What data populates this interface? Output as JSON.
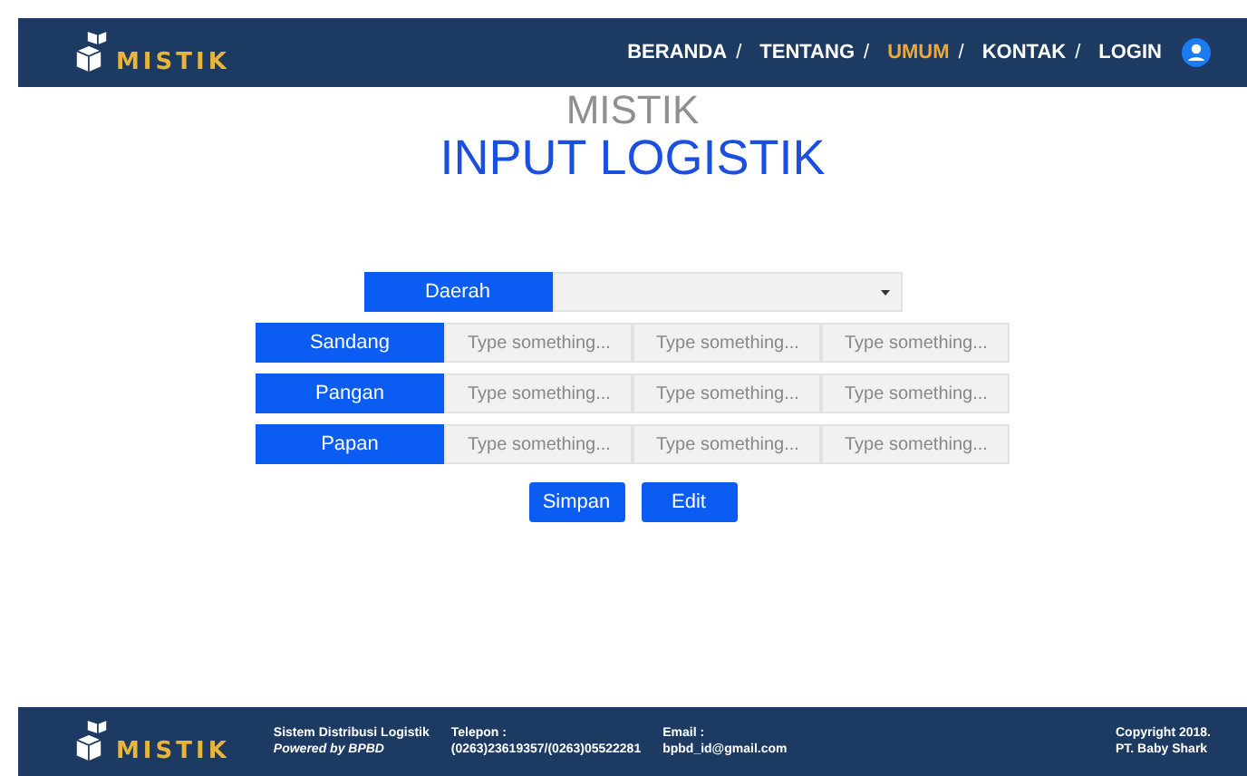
{
  "header": {
    "logo_text": "MISTIK",
    "nav": [
      {
        "label": "BERANDA",
        "selected": false
      },
      {
        "label": "TENTANG",
        "selected": false
      },
      {
        "label": "UMUM",
        "selected": true
      },
      {
        "label": "KONTAK",
        "selected": false
      },
      {
        "label": "LOGIN",
        "selected": false
      }
    ],
    "separator": "/"
  },
  "page": {
    "backdrop_text": "MISTIK",
    "title": "INPUT LOGISTIK"
  },
  "form": {
    "region": {
      "label": "Daerah"
    },
    "rows": [
      {
        "label": "Sandang",
        "fields": [
          {
            "placeholder": "Type something..."
          },
          {
            "placeholder": "Type something..."
          },
          {
            "placeholder": "Type something..."
          }
        ]
      },
      {
        "label": "Pangan",
        "fields": [
          {
            "placeholder": "Type something..."
          },
          {
            "placeholder": "Type something..."
          },
          {
            "placeholder": "Type something..."
          }
        ]
      },
      {
        "label": "Papan",
        "fields": [
          {
            "placeholder": "Type something..."
          },
          {
            "placeholder": "Type something..."
          },
          {
            "placeholder": "Type something..."
          }
        ]
      }
    ],
    "buttons": [
      "Simpan",
      "Edit"
    ]
  },
  "footer": {
    "logo_text": "MISTIK",
    "about": {
      "line1": "Sistem Distribusi Logistik",
      "line2": "*Powered by BPBD*"
    },
    "phone": {
      "label": "Telepon :",
      "value": "(0263)23619357/(0263)05522281"
    },
    "email": {
      "label": "Email :",
      "value": "bpbd_id@gmail.com"
    },
    "copyright": {
      "line1": "Copyright 2018.",
      "line2": "PT. Baby Shark"
    }
  }
}
